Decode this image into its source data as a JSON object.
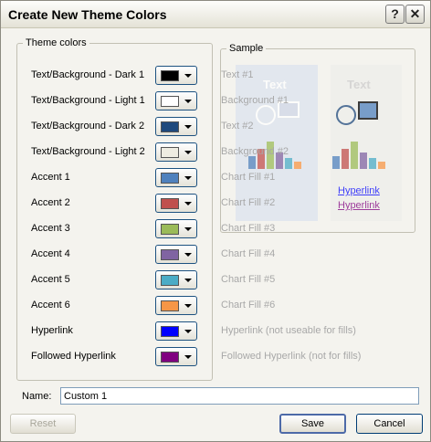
{
  "window": {
    "title": "Create New Theme Colors",
    "help_glyph": "?",
    "close_glyph": "✕"
  },
  "theme_colors": {
    "group_label": "Theme colors",
    "rows": [
      {
        "label": "Text/Background - Dark 1",
        "color": "#000000"
      },
      {
        "label": "Text/Background - Light 1",
        "color": "#ffffff"
      },
      {
        "label": "Text/Background - Dark 2",
        "color": "#1f497d"
      },
      {
        "label": "Text/Background - Light 2",
        "color": "#eeece1"
      },
      {
        "label": "Accent 1",
        "color": "#4f81bd"
      },
      {
        "label": "Accent 2",
        "color": "#c0504d"
      },
      {
        "label": "Accent 3",
        "color": "#9bbb59"
      },
      {
        "label": "Accent 4",
        "color": "#8064a2"
      },
      {
        "label": "Accent 5",
        "color": "#4bacc6"
      },
      {
        "label": "Accent 6",
        "color": "#f79646"
      },
      {
        "label": "Hyperlink",
        "color": "#0000ff"
      },
      {
        "label": "Followed Hyperlink",
        "color": "#800080"
      }
    ]
  },
  "sample": {
    "group_label": "Sample",
    "labels": [
      "Text #1",
      "Background #1",
      "Text #2",
      "Background #2",
      "Chart Fill #1",
      "Chart Fill #2",
      "Chart Fill #3",
      "Chart Fill #4",
      "Chart Fill #5",
      "Chart Fill #6",
      "Hyperlink (not useable for fills)",
      "Followed Hyperlink (not for fills)"
    ],
    "preview": {
      "left_text": "Text",
      "right_text": "Text",
      "hyperlink": "Hyperlink",
      "followed_hyperlink": "Hyperlink"
    }
  },
  "name": {
    "label": "Name:",
    "value": "Custom 1"
  },
  "buttons": {
    "reset": "Reset",
    "save": "Save",
    "cancel": "Cancel"
  }
}
